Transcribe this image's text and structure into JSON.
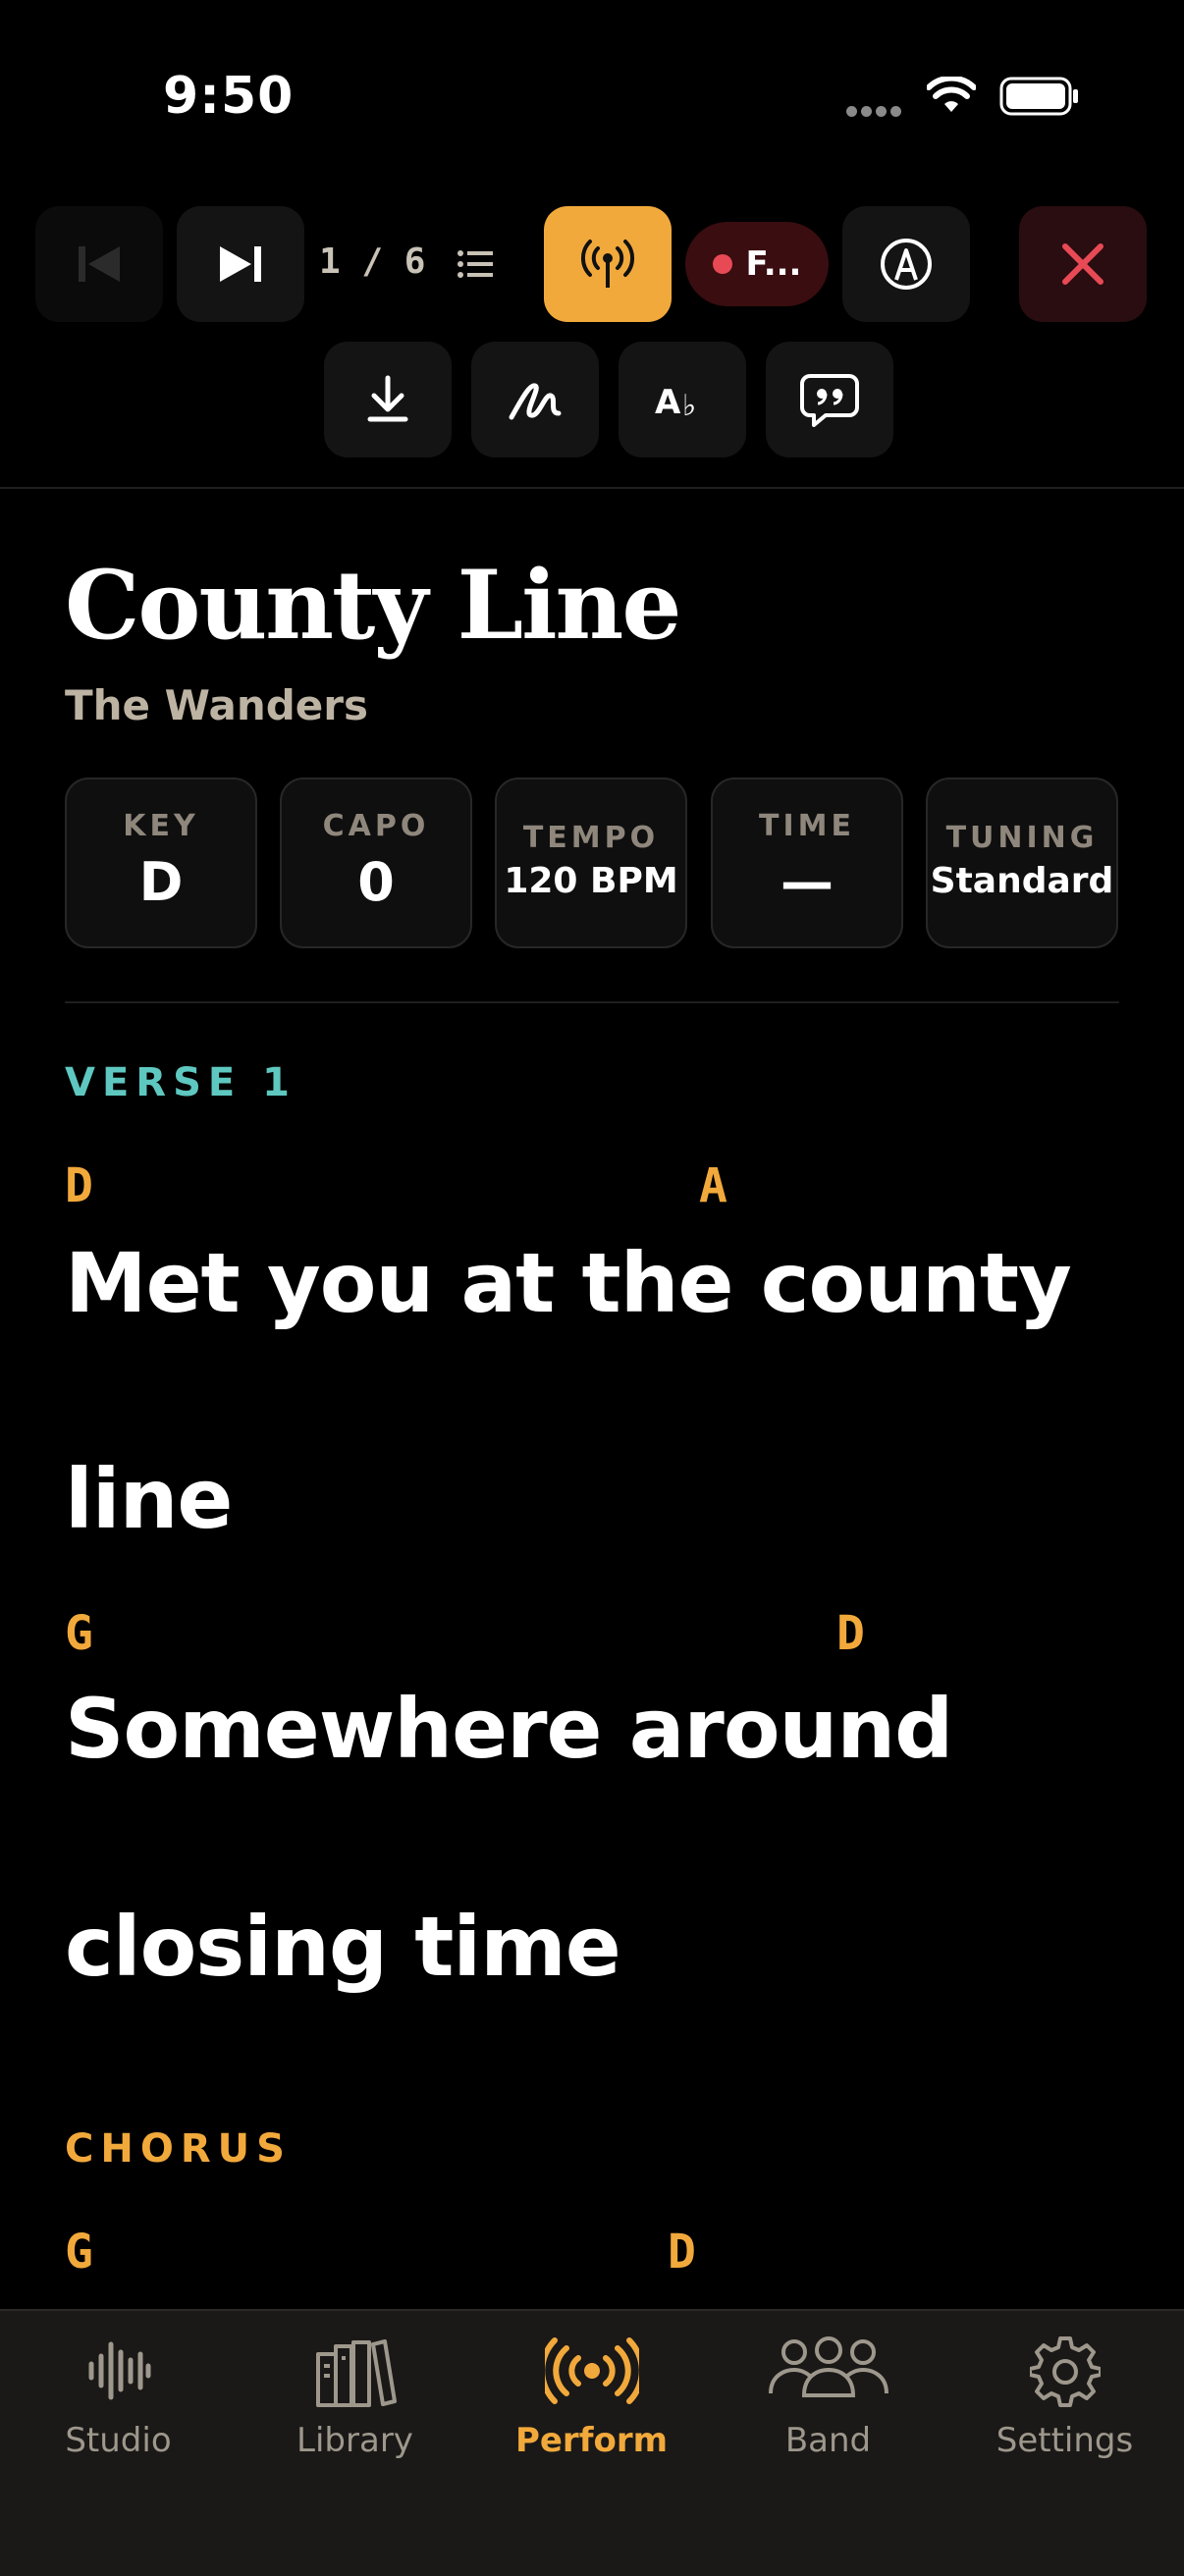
{
  "status": {
    "time": "9:50"
  },
  "toolbar": {
    "counter": "1 / 6",
    "recording_label": "F..."
  },
  "song": {
    "title": "County Line",
    "artist": "The Wanders"
  },
  "meta": [
    {
      "key": "KEY",
      "value": "D"
    },
    {
      "key": "CAPO",
      "value": "0"
    },
    {
      "key": "TEMPO",
      "value": "120 BPM"
    },
    {
      "key": "TIME",
      "value": "—"
    },
    {
      "key": "TUNING",
      "value": "Standard"
    }
  ],
  "sections": {
    "verse1": {
      "label": "VERSE 1",
      "line1": {
        "chord1": "D",
        "chord2": "A",
        "text_a": "Met you at the county",
        "text_b": "line"
      },
      "line2": {
        "chord1": "G",
        "chord2": "D",
        "text_a": "Somewhere around",
        "text_b": "closing time"
      }
    },
    "chorus": {
      "label": "CHORUS",
      "line1": {
        "chord1": "G",
        "chord2": "D"
      }
    }
  },
  "colors": {
    "accent": "#f2a93b",
    "verse": "#5ec8c0",
    "chorus": "#f2a93b",
    "record": "#e84a55",
    "close": "#e84a55"
  },
  "tabs": [
    {
      "label": "Studio",
      "icon": "waveform-icon"
    },
    {
      "label": "Library",
      "icon": "books-icon"
    },
    {
      "label": "Perform",
      "icon": "broadcast-icon",
      "active": true
    },
    {
      "label": "Band",
      "icon": "people-icon"
    },
    {
      "label": "Settings",
      "icon": "gear-icon"
    }
  ]
}
